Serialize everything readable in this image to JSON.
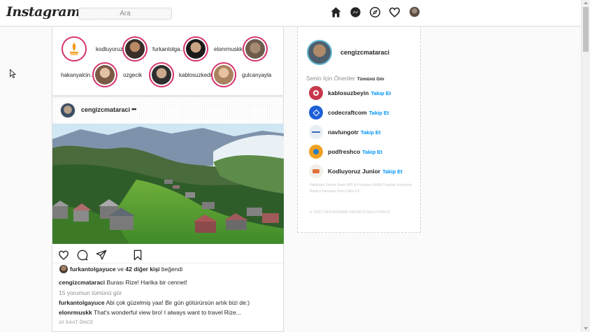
{
  "header": {
    "logo": "Instagram",
    "search_placeholder": "Ara",
    "icons": [
      "home-icon",
      "messenger-icon",
      "explore-icon",
      "heart-icon",
      "profile-avatar"
    ]
  },
  "stories": [
    {
      "name": "",
      "kind": "logo"
    },
    {
      "name": "kodluyoruz"
    },
    {
      "name": "furkantolga..."
    },
    {
      "name": "elonrmuskk"
    },
    {
      "name": "hakanyalcin..."
    },
    {
      "name": "ozgecik"
    },
    {
      "name": "kablosuzkedi"
    },
    {
      "name": "gulcanyayla"
    }
  ],
  "post": {
    "username": "cengizcmataraci",
    "more": "•••",
    "likes": {
      "user": "furkantolgayuce",
      "connector": "ve",
      "others": "42 diğer kişi",
      "suffix": "beğendi"
    },
    "caption": {
      "user": "cengizcmataraci",
      "text": "Burası Rize! Harika bir cennet!"
    },
    "view_all_comments": "15 yorumun tümünü gör",
    "comments": [
      {
        "user": "furkantolgayuce",
        "text": "Abi çok güzelmiş yaa! Bir gün götürürsün artık bizi de:)"
      },
      {
        "user": "elonrmuskk",
        "text": "That's wonderful view bro! I always want to travel Rize..."
      }
    ],
    "time": "10 SAAT ÖNCE"
  },
  "sidebar": {
    "username": "cengizcmataraci",
    "suggestions_title": "Senin İçin Öneriler",
    "see_all": "Tümünü Gör",
    "follow_label": "Takip Et",
    "suggestions": [
      {
        "name": "kablosuzbeyin",
        "color": "#c8374a"
      },
      {
        "name": "codecraftcom",
        "color": "#1d5fd6"
      },
      {
        "name": "navlungotr",
        "color": "#e9eef5"
      },
      {
        "name": "podfreshco",
        "color": "#f0a020"
      },
      {
        "name": "Kodluyoruz Junior",
        "color": "#f2efe9"
      }
    ],
    "footer_links": "Hakkında Yardım Basın API İş Fırsatları Gizlilik Koşullar Konumlar Başlıca Hesaplar Konu Diller Dil",
    "copyright": "© 2021 INSTAGRAM FROM KODLUYORUZ"
  }
}
